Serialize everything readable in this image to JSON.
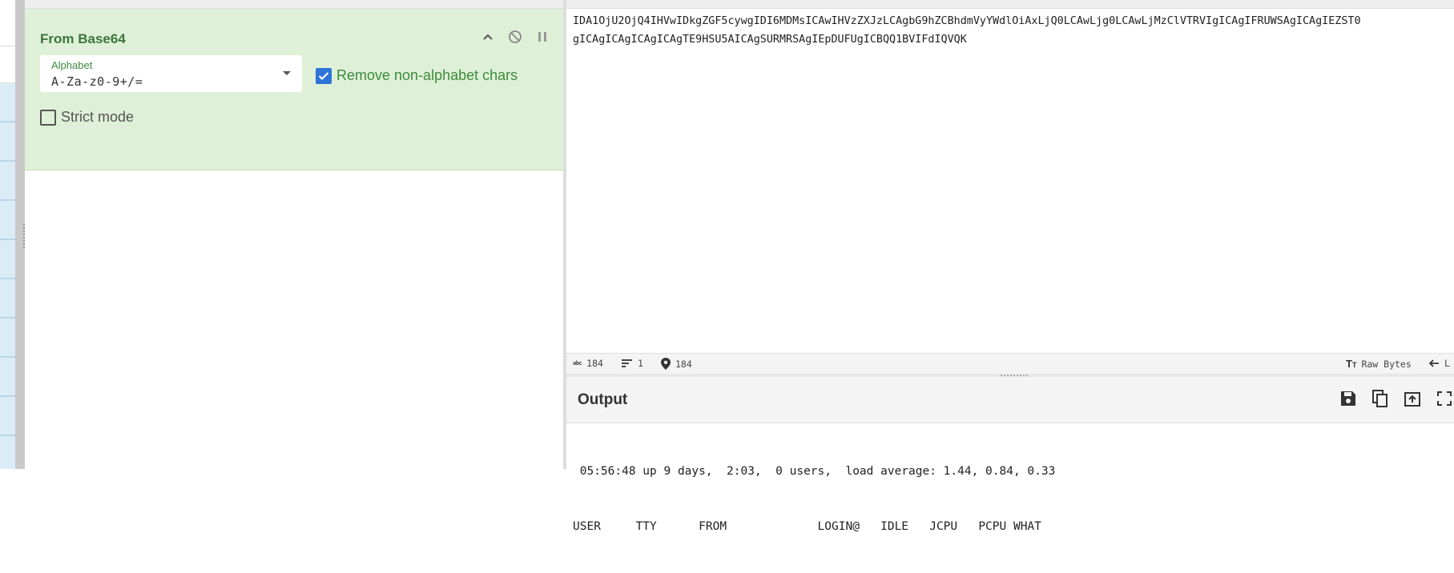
{
  "operation": {
    "title": "From Base64",
    "alphabet_label": "Alphabet",
    "alphabet_value": "A-Za-z0-9+/=",
    "remove_non_alphabet_label": "Remove non-alphabet chars",
    "remove_non_alphabet_checked": true,
    "strict_mode_label": "Strict mode",
    "strict_mode_checked": false
  },
  "input": {
    "lines": [
      "IDA1OjU2OjQ4IHVwIDkgZGF5cywgIDI6MDMsICAwIHVzZXJzLCAgbG9hZCBhdmVyYWdlOiAxLjQ0LCAwLjg0LCAwLjMzClVTRVIgICAgIFRUWSAgICAgIEZST0",
      "gICAgICAgICAgICAgTE9HSU5AICAgSURMRSAgIEpDUFUgICBQQ1BVIFdIQVQK"
    ]
  },
  "status": {
    "length_label": "184",
    "lines_label": "1",
    "position_label": "184",
    "encoding_label": "Raw Bytes",
    "eol_label": "L"
  },
  "output": {
    "title": "Output",
    "lines": [
      " 05:56:48 up 9 days,  2:03,  0 users,  load average: 1.44, 0.84, 0.33",
      "USER     TTY      FROM             LOGIN@   IDLE   JCPU   PCPU WHAT"
    ]
  },
  "icons": {
    "collapse": "chevron-up-icon",
    "disable": "disable-icon",
    "pause": "pause-icon",
    "save": "save-icon",
    "copy": "copy-icon",
    "replace_input": "replace-input-icon",
    "maximise": "maximise-icon"
  },
  "colors": {
    "op_card_bg": "#dff0d8",
    "op_title": "#3c763d",
    "checkbox_accent": "#2e74d8"
  }
}
